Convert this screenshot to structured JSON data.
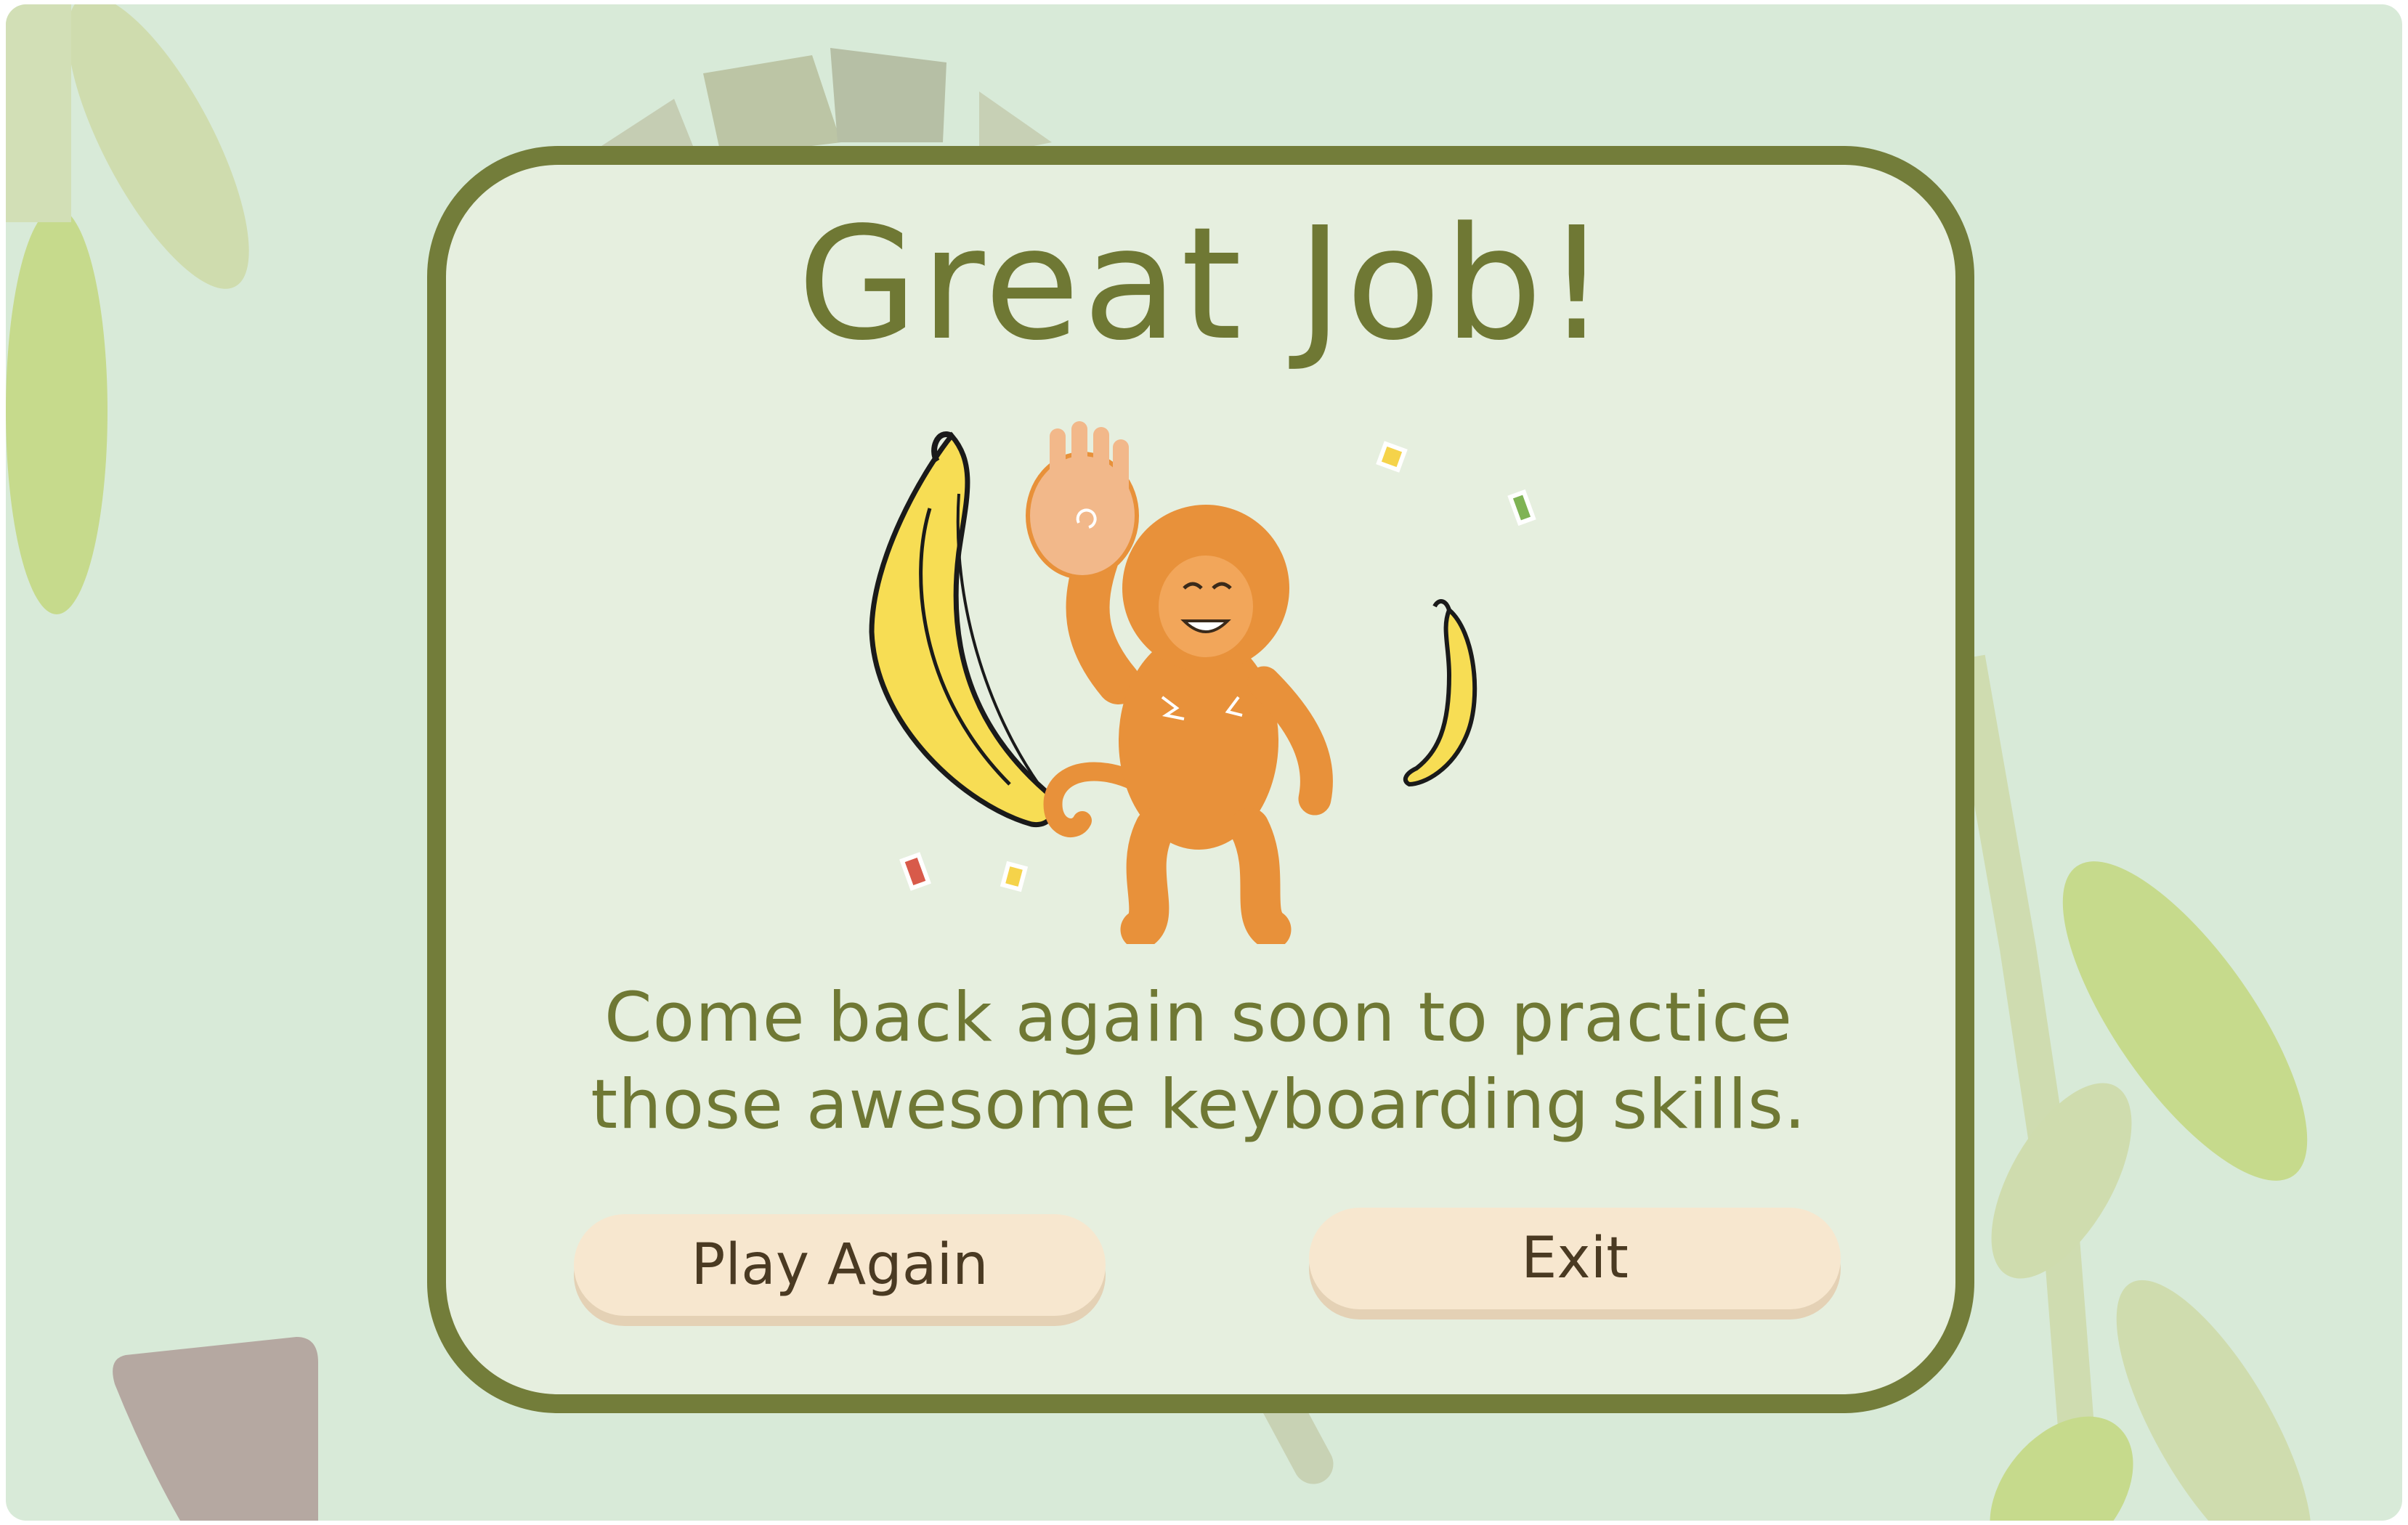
{
  "title": "Great Job!",
  "message": {
    "line1": "Come back again soon to practice",
    "line2": "those awesome keyboarding skills."
  },
  "buttons": {
    "play_again": "Play Again",
    "exit": "Exit"
  },
  "colors": {
    "background": "#d8ead8",
    "card_fill": "#e6efdf",
    "card_border": "#737d3a",
    "title_text": "#6f7834",
    "button_fill": "#f7e7cf",
    "button_text": "#4a3a22"
  },
  "illustration": {
    "monkey": "waving-monkey-icon",
    "bananas": "banana-icon"
  }
}
